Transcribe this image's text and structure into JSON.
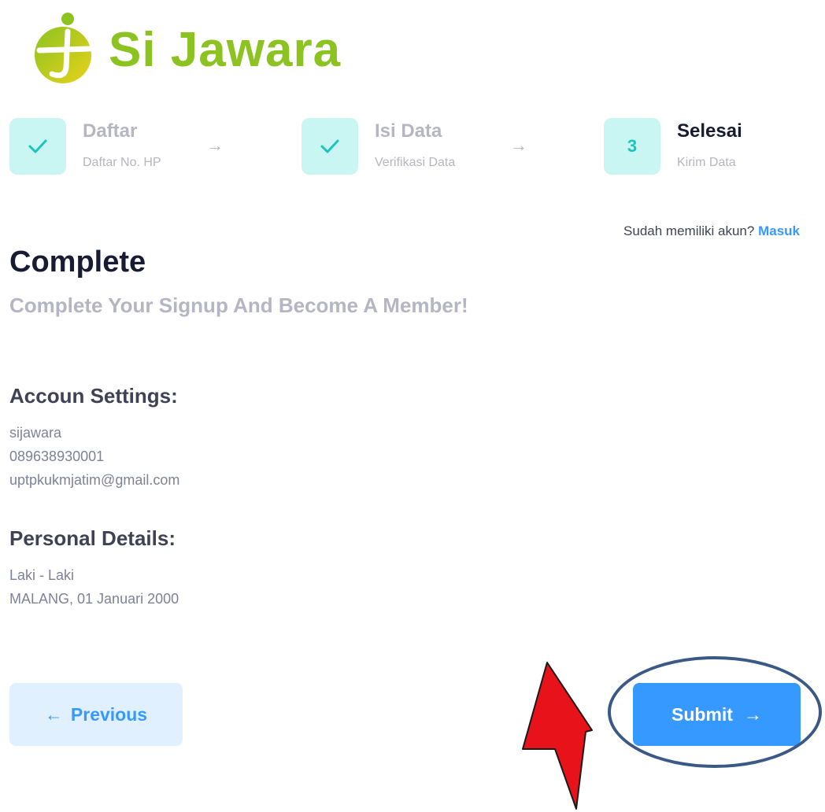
{
  "logo": {
    "text": "Si Jawara"
  },
  "stepper": {
    "steps": [
      {
        "title": "Daftar",
        "subtitle": "Daftar No. HP",
        "state": "done"
      },
      {
        "title": "Isi Data",
        "subtitle": "Verifikasi Data",
        "state": "done"
      },
      {
        "title": "Selesai",
        "subtitle": "Kirim Data",
        "state": "current",
        "number": "3"
      }
    ],
    "arrow": "→"
  },
  "signin": {
    "prompt": "Sudah memiliki akun?",
    "link": "Masuk"
  },
  "heading": {
    "title": "Complete",
    "subtitle": "Complete Your Signup And Become A Member!"
  },
  "account": {
    "title": "Accoun Settings:",
    "username": "sijawara",
    "phone": "089638930001",
    "email": "uptpkukmjatim@gmail.com"
  },
  "personal": {
    "title": "Personal Details:",
    "gender": "Laki - Laki",
    "birth": "MALANG, 01 Januari 2000"
  },
  "buttons": {
    "previous": "Previous",
    "submit": "Submit",
    "prev_arrow": "←",
    "next_arrow": "→"
  },
  "colors": {
    "primary": "#3699ff",
    "success": "#1bc5bd",
    "brand": "#8cc321",
    "annotation_arrow": "#e8121a",
    "annotation_ellipse": "#3a5a85"
  }
}
